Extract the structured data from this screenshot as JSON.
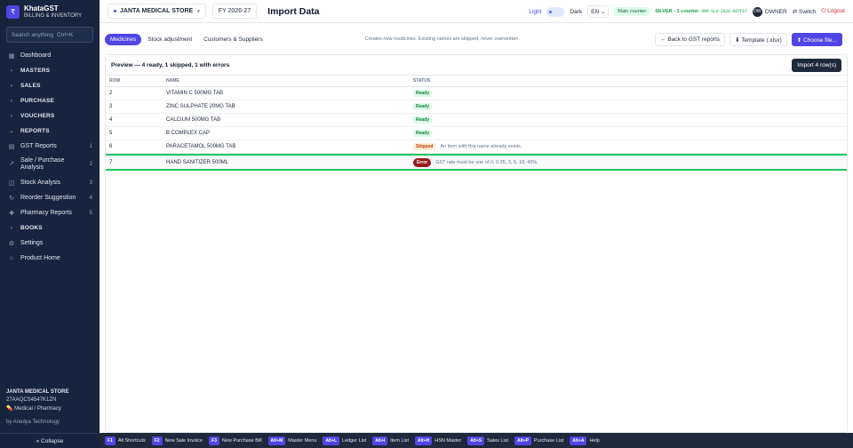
{
  "brand": {
    "name": "KhataGST",
    "subtitle": "BILLING & INVENTORY",
    "logo_glyph": "₹"
  },
  "search": {
    "placeholder": "Search anything",
    "shortcut": "Ctrl+K"
  },
  "sidebar": {
    "items": [
      {
        "label": "Dashboard",
        "icon": "grid-icon",
        "glyph": "▦",
        "type": "item"
      },
      {
        "label": "MASTERS",
        "icon": "chevron-right-icon",
        "glyph": "›",
        "type": "section"
      },
      {
        "label": "SALES",
        "icon": "chevron-right-icon",
        "glyph": "›",
        "type": "section"
      },
      {
        "label": "PURCHASE",
        "icon": "chevron-right-icon",
        "glyph": "›",
        "type": "section"
      },
      {
        "label": "VOUCHERS",
        "icon": "chevron-right-icon",
        "glyph": "›",
        "type": "section"
      },
      {
        "label": "REPORTS",
        "icon": "chevron-down-icon",
        "glyph": "⌄",
        "type": "section"
      },
      {
        "label": "GST Reports",
        "icon": "receipt-icon",
        "glyph": "▤",
        "count": "1",
        "type": "item"
      },
      {
        "label": "Sale / Purchase Analysis",
        "icon": "chart-icon",
        "glyph": "↗",
        "count": "2",
        "type": "item"
      },
      {
        "label": "Stock Analysis",
        "icon": "box-icon",
        "glyph": "◫",
        "count": "3",
        "type": "item"
      },
      {
        "label": "Reorder Suggestion",
        "icon": "refresh-icon",
        "glyph": "↻",
        "count": "4",
        "type": "item"
      },
      {
        "label": "Pharmacy Reports",
        "icon": "pill-icon",
        "glyph": "✚",
        "count": "5",
        "type": "item"
      },
      {
        "label": "BOOKS",
        "icon": "chevron-right-icon",
        "glyph": "›",
        "type": "section"
      },
      {
        "label": "Settings",
        "icon": "gear-icon",
        "glyph": "⚙",
        "type": "item"
      },
      {
        "label": "Product Home",
        "icon": "home-icon",
        "glyph": "⌂",
        "type": "item"
      }
    ],
    "footer": {
      "store": "JANTA MEDICAL STORE",
      "gstin": "27AAQCS4547K1ZN",
      "category": "Medical / Pharmacy",
      "by": "by Anedya Technology"
    },
    "collapse_label": "« Collapse"
  },
  "topbar": {
    "store": "JANTA MEDICAL STORE",
    "fy": "FY 2026-27",
    "title": "Import Data",
    "theme_light": "Light",
    "theme_dark": "Dark",
    "lang": "EN",
    "counter": "Main counter",
    "license_plan": "SILVER - 1 counter",
    "license_code": "ANR-SLV-2026-A07F67",
    "avatar_initials": "OW",
    "role": "OWNER",
    "switch_label": "Switch",
    "logout_label": "Logout"
  },
  "toolbar": {
    "tabs": [
      "Medicines",
      "Stock adjustment",
      "Customers & Suppliers"
    ],
    "hint": "Creates new medicines. Existing names are skipped, never overwritten.",
    "back_label": "← Back to GST reports",
    "template_label": "⬇ Template (.xlsx)",
    "choose_label": "⬆ Choose file..."
  },
  "preview": {
    "title": "Preview — 4 ready, 1 skipped, 1 with errors",
    "import_label": "Import 4 row(s)",
    "columns": [
      "ROW",
      "NAME",
      "STATUS"
    ],
    "rows": [
      {
        "row": "2",
        "name": "VITAMIN C 500MG TAB",
        "status": "Ready",
        "message": ""
      },
      {
        "row": "3",
        "name": "ZINC SULPHATE 20MG TAB",
        "status": "Ready",
        "message": ""
      },
      {
        "row": "4",
        "name": "CALCIUM 500MG TAB",
        "status": "Ready",
        "message": ""
      },
      {
        "row": "5",
        "name": "B COMPLEX CAP",
        "status": "Ready",
        "message": ""
      },
      {
        "row": "6",
        "name": "PARACETAMOL 500MG TAB",
        "status": "Skipped",
        "message": "An item with this name already exists."
      },
      {
        "row": "7",
        "name": "HAND SANITIZER 500ML",
        "status": "Error",
        "message": "GST rate must be one of 0, 0.25, 3, 5, 18, 40%."
      }
    ]
  },
  "shortcuts": [
    {
      "key": "F1",
      "label": "All Shortcuts"
    },
    {
      "key": "F2",
      "label": "New Sale Invoice"
    },
    {
      "key": "F3",
      "label": "New Purchase Bill"
    },
    {
      "key": "Alt+M",
      "label": "Master Menu"
    },
    {
      "key": "Alt+L",
      "label": "Ledger List"
    },
    {
      "key": "Alt+I",
      "label": "Item List"
    },
    {
      "key": "Alt+H",
      "label": "HSN Master"
    },
    {
      "key": "Alt+S",
      "label": "Sales List"
    },
    {
      "key": "Alt+P",
      "label": "Purchase List"
    },
    {
      "key": "Alt+A",
      "label": "Help"
    }
  ],
  "colors": {
    "accent": "#4f46e5",
    "sidebar": "#17243d",
    "ready": "#15803d",
    "skipped": "#c2410c",
    "error": "#991b1b",
    "highlight": "#22c55e"
  }
}
